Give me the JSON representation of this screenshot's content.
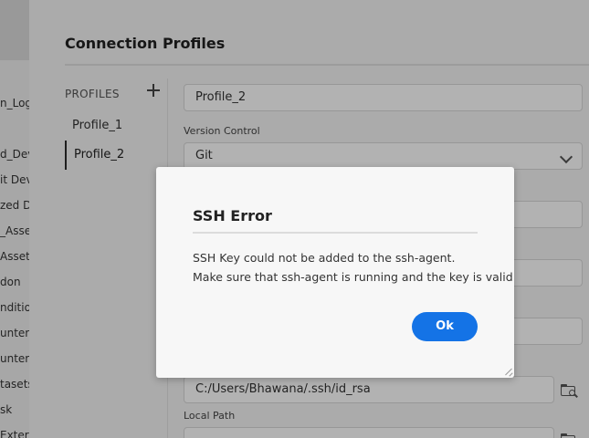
{
  "background_list": {
    "items": [
      "n_Log",
      "d_Dev",
      "it Dev",
      "zed D",
      "_Asset",
      "Assets",
      "don",
      "nditio",
      "unter",
      "unters",
      "tasets",
      "sk",
      "Exter"
    ]
  },
  "panel": {
    "title": "Connection Profiles",
    "profiles_header": "PROFILES",
    "profiles": [
      "Profile_1",
      "Profile_2"
    ],
    "active_profile": "Profile_2",
    "name_value": "Profile_2",
    "version_control_label": "Version Control",
    "version_control_value": "Git",
    "ssh_key_value": "C:/Users/Bhawana/.ssh/id_rsa",
    "local_path_label": "Local Path"
  },
  "modal": {
    "title": "SSH Error",
    "line1": "SSH Key could not be added to the ssh-agent.",
    "line2": "Make sure that ssh-agent is running and the key is valid",
    "ok_label": "Ok"
  },
  "colors": {
    "accent": "#1473e6"
  }
}
